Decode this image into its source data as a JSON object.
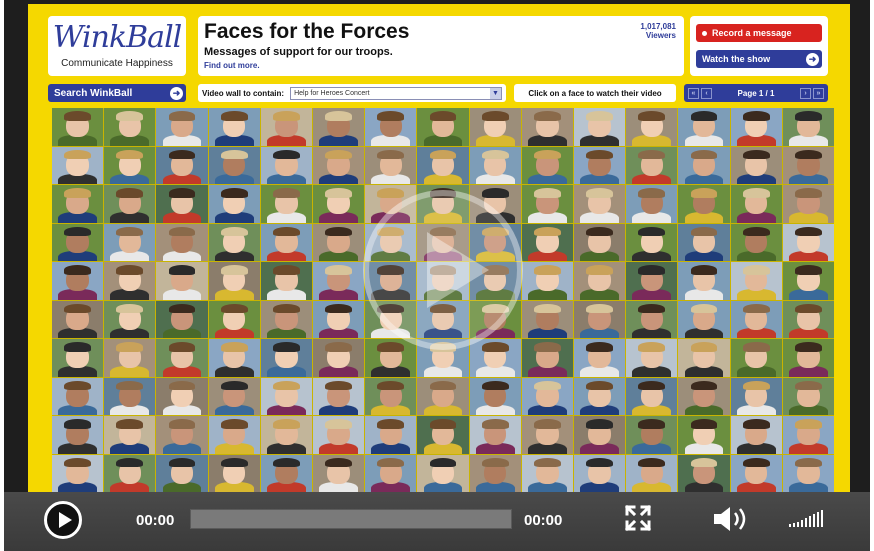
{
  "header": {
    "logo": "WinkBall",
    "tagline": "Communicate Happiness",
    "title": "Faces for the Forces",
    "subtitle": "Messages of support for our troops.",
    "find_out_more": "Find out more.",
    "viewer_count": "1,017,081",
    "viewer_label": "Viewers",
    "record_button": "Record a message",
    "watch_button": "Watch the show"
  },
  "toolbar": {
    "search_button": "Search WinkBall",
    "wall_label": "Video wall to contain:",
    "wall_selected": "Help for Heroes Concert",
    "instruction": "Click on a face to watch their video",
    "page_label": "Page 1 / 1"
  },
  "player": {
    "current_time": "00:00",
    "duration": "00:00",
    "progress": 0
  },
  "colors": {
    "background_yellow": "#f5d800",
    "brand_blue": "#2f3d9a",
    "record_red": "#d8231f",
    "player_bar": "#3a3a3a"
  },
  "icons": {
    "play": "play-icon",
    "fullscreen": "fullscreen-icon",
    "volume": "volume-icon",
    "signal": "signal-icon"
  }
}
